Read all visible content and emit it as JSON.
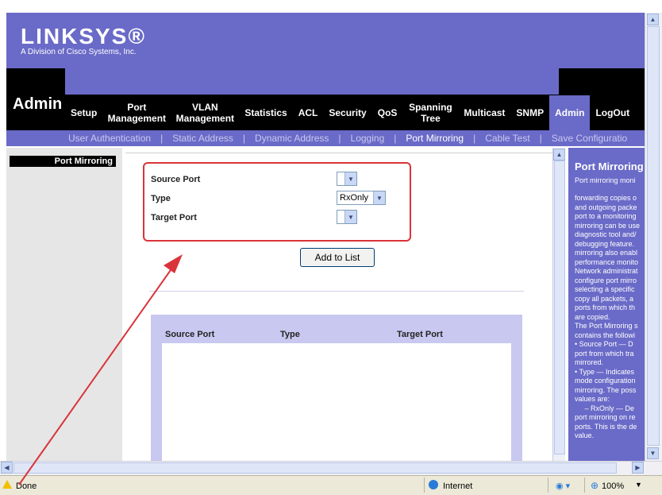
{
  "brand": {
    "logo": "LINKSYS®",
    "tagline": "A Division of Cisco Systems, Inc."
  },
  "header": {
    "section_title": "Admin"
  },
  "nav": [
    {
      "label": "Setup"
    },
    {
      "label": "Port Management"
    },
    {
      "label": "VLAN Management"
    },
    {
      "label": "Statistics"
    },
    {
      "label": "ACL"
    },
    {
      "label": "Security"
    },
    {
      "label": "QoS"
    },
    {
      "label": "Spanning Tree"
    },
    {
      "label": "Multicast"
    },
    {
      "label": "SNMP"
    },
    {
      "label": "Admin",
      "active": true
    },
    {
      "label": "LogOut"
    }
  ],
  "subnav": [
    {
      "label": "User Authentication"
    },
    {
      "label": "Static Address"
    },
    {
      "label": "Dynamic Address"
    },
    {
      "label": "Logging"
    },
    {
      "label": "Port Mirroring",
      "active": true
    },
    {
      "label": "Cable Test"
    },
    {
      "label": "Save Configuratio"
    }
  ],
  "sidebar": {
    "title": "Port Mirroring"
  },
  "form": {
    "source_port_label": "Source Port",
    "type_label": "Type",
    "target_port_label": "Target Port",
    "source_port_value": "",
    "type_value": "RxOnly",
    "target_port_value": "",
    "add_button": "Add to List"
  },
  "table": {
    "columns": [
      "Source Port",
      "Type",
      "Target Port"
    ],
    "rows": []
  },
  "help": {
    "title": "Port Mirroring",
    "subtitle": "Port mirroring moni",
    "body": "forwarding copies o\nand outgoing packe\nport to a monitoring\nmirroring can be use\ndiagnostic tool and/\ndebugging feature.\nmirroring also enabl\nperformance monito\nNetwork administrat\nconfigure port mirro\nselecting a specific\ncopy all packets, a\nports from which th\nare copied.\nThe Port Mirroring s\ncontains the followi\n• Source Port — D\nport from which tra\nmirrored.\n• Type — Indicates\nmode configuration\nmirroring. The poss\nvalues are:\n     – RxOnly — De\nport mirroring on re\nports. This is the de\nvalue."
  },
  "status": {
    "text": "Done",
    "zone": "Internet",
    "zoom": "100%"
  },
  "colors": {
    "brand_purple": "#6a6ac8",
    "annotation_red": "#d9343a"
  }
}
